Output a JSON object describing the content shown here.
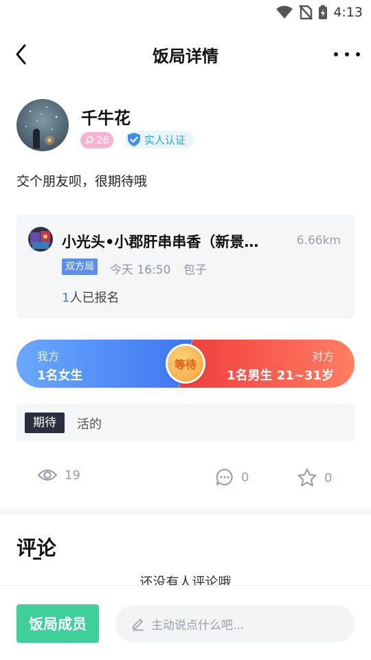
{
  "status_bar": {
    "time": "4:13"
  },
  "nav": {
    "title": "饭局详情"
  },
  "profile": {
    "name": "千牛花",
    "female_level": "26",
    "verify_label": "实人认证"
  },
  "post": {
    "text": "交个朋友呗，很期待哦"
  },
  "restaurant": {
    "name": "小光头•小郡肝串串香（新景…",
    "distance": "6.66km",
    "type_tag": "双方局",
    "time": "今天 16:50",
    "payment": "包子",
    "signup_count": "1",
    "signup_suffix": "人已报名"
  },
  "match": {
    "our_label": "我方",
    "our_value": "1名女生",
    "their_label": "对方",
    "their_value": "1名男生  21~31岁",
    "status": "等待"
  },
  "expectation": {
    "tag": "期待",
    "text": "活的"
  },
  "stats": {
    "views": "19",
    "comments": "0",
    "favorites": "0"
  },
  "comments": {
    "title": "评论",
    "empty_text": "还没有人评论哦"
  },
  "bottom": {
    "members_button": "饭局成员",
    "input_placeholder": "主动说点什么吧..."
  },
  "icons": {
    "back": "chevron-left-icon",
    "more": "more-dots-icon",
    "female": "female-icon",
    "verify": "shield-check-icon",
    "views": "eye-icon",
    "comments": "comment-bubble-icon",
    "favorite": "star-icon",
    "edit": "pencil-icon"
  },
  "colors": {
    "blue_accent": "#3f7fe6",
    "red_accent": "#f13b3b",
    "green_button": "#3fcf9b",
    "female_badge": "#f7b3d0",
    "verify_text": "#2aa2d3"
  }
}
